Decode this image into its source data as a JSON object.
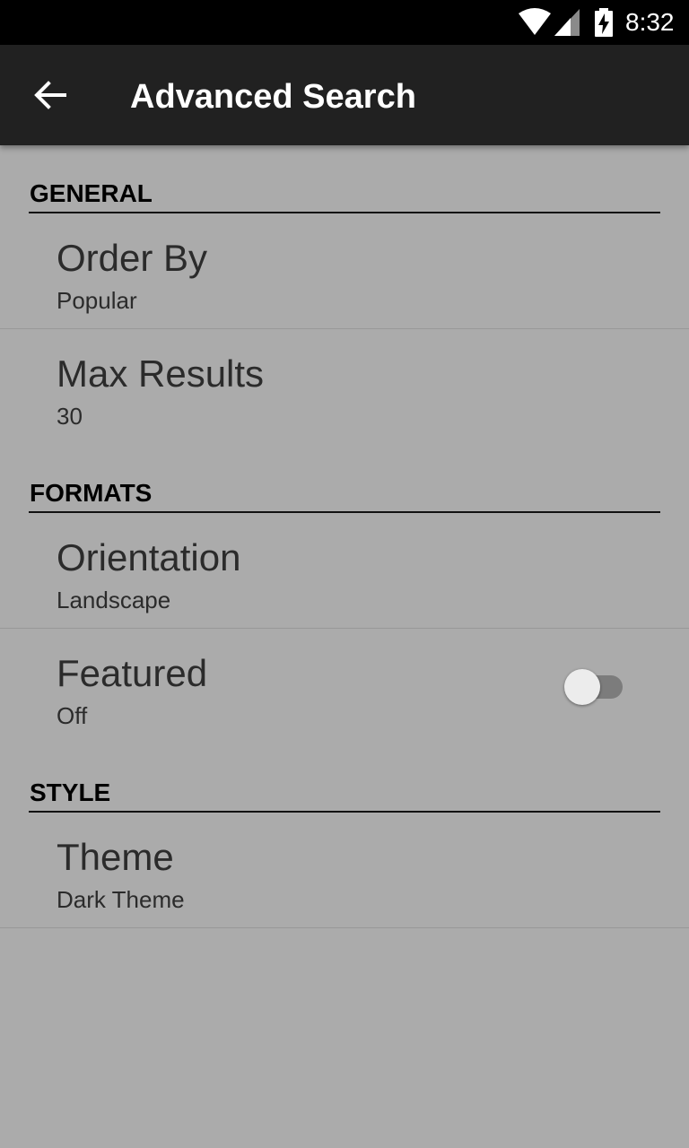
{
  "status_bar": {
    "time": "8:32",
    "icons": [
      "wifi-icon",
      "cell-signal-icon",
      "battery-charging-icon"
    ]
  },
  "app_bar": {
    "title": "Advanced Search",
    "back_icon": "arrow-left-icon"
  },
  "sections": {
    "general": {
      "header": "GENERAL",
      "order_by": {
        "title": "Order By",
        "summary": "Popular"
      },
      "max_results": {
        "title": "Max Results",
        "summary": "30"
      }
    },
    "formats": {
      "header": "FORMATS",
      "orientation": {
        "title": "Orientation",
        "summary": "Landscape"
      },
      "featured": {
        "title": "Featured",
        "summary": "Off",
        "enabled": false
      }
    },
    "style": {
      "header": "STYLE",
      "theme": {
        "title": "Theme",
        "summary": "Dark Theme"
      }
    }
  },
  "colors": {
    "status_bar": "#000000",
    "app_bar": "#212121",
    "background": "#ababab",
    "text": "#2b2b2b"
  }
}
